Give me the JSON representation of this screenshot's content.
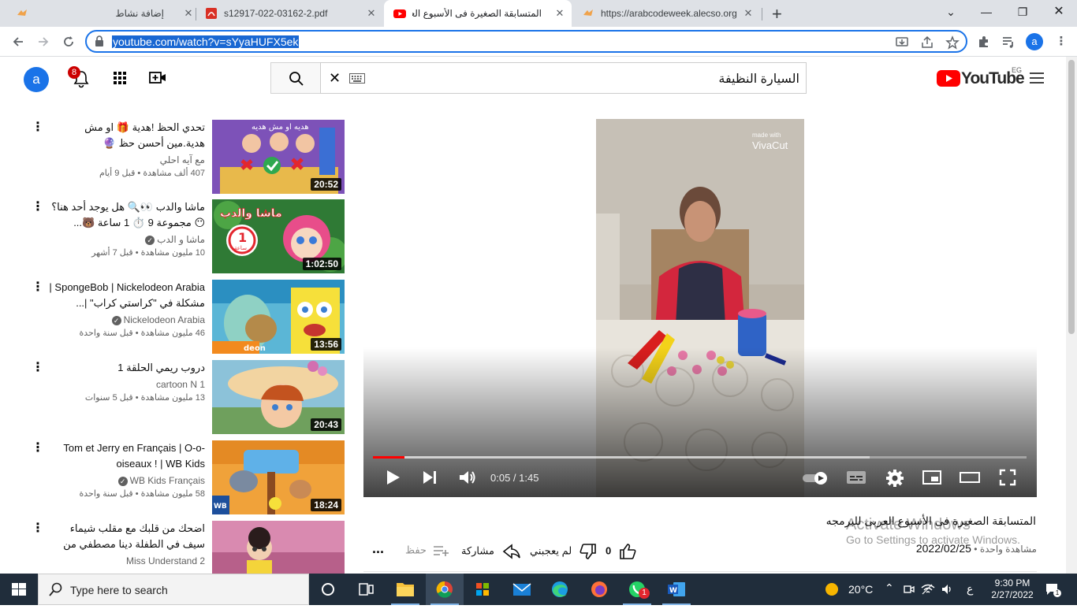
{
  "browser": {
    "tabs": [
      {
        "title": "إضافة نشاط",
        "icon": "arabcode-icon"
      },
      {
        "title": "s12917-022-03162-2.pdf",
        "icon": "pdf-icon"
      },
      {
        "title": "المتسابقة الصغيرة فى الأسبوع العر",
        "icon": "youtube-icon",
        "active": true
      },
      {
        "title": "https://arabcodeweek.alecso.org",
        "icon": "arabcode-icon"
      }
    ],
    "new_tab": "+",
    "url": "youtube.com/watch?v=sYyaHUFX5ek",
    "profile_initial": "a"
  },
  "youtube": {
    "avatar_initial": "a",
    "notification_count": "8",
    "search_query": "السيارة النظيفة",
    "logo_text": "YouTube",
    "country_code": "EG"
  },
  "related": [
    {
      "title": "تحدي الحظ !هدية 🎁 او مش هدية.مين أحسن حظ 🔮",
      "channel": "مع آيه احلي",
      "verified": false,
      "stats": "407 ألف مشاهدة • قبل 9 أيام",
      "duration": "20:52",
      "thumb_color": "#8e5fa8"
    },
    {
      "title": "ماشا والدب 👀🔍 هل يوجد أحد هنا؟ 😶 مجموعة 9 ⏱️ 1 ساعة 🐻...",
      "channel": "ماشا و الدب",
      "verified": true,
      "stats": "10 مليون مشاهدة • قبل 7 أشهر",
      "duration": "1:02:50",
      "thumb_color": "#3f8f3a"
    },
    {
      "title": "SpongeBob | Nickelodeon Arabia | مشكلة في \"كراستي كراب\" |...",
      "channel": "Nickelodeon Arabia",
      "verified": true,
      "stats": "46 مليون مشاهدة • قبل سنة واحدة",
      "duration": "13:56",
      "thumb_color": "#e9c430"
    },
    {
      "title": "دروب ريمي الحلقة 1",
      "channel": "cartoon N 1",
      "verified": false,
      "stats": "13 مليون مشاهدة • قبل 5 سنوات",
      "duration": "20:43",
      "thumb_color": "#c98a55"
    },
    {
      "title": "Tom et Jerry en Français | O-o-oiseaux ! | WB Kids",
      "channel": "WB Kids Français",
      "verified": true,
      "stats": "58 مليون مشاهدة • قبل سنة واحدة",
      "duration": "18:24",
      "thumb_color": "#3d6fa8"
    },
    {
      "title": "اضحك من قلبك مع مقلب شيماء سيف في الطفلة دينا مصطفي من برنامج ميس...",
      "channel": "Miss Understand 2",
      "verified": false,
      "stats": "",
      "duration": "",
      "thumb_color": "#c27a9a"
    }
  ],
  "player": {
    "time_current": "0:05",
    "time_total": "1:45",
    "time_text": "0:05 / 1:45",
    "progress": 0.048,
    "watermark_small": "made with",
    "watermark": "VivaCut"
  },
  "video": {
    "title": "المتسابقة الصغيرة فى الأسبوع العربى للبرمجه",
    "views": "مشاهدة واحدة •",
    "date": "2022/02/25",
    "likes": "0",
    "dislike_label": "لم يعجبني",
    "share_label": "مشاركة",
    "save_label": "حفظ",
    "more": "..."
  },
  "watermark": {
    "line1": "Activate Windows",
    "line2": "Go to Settings to activate Windows."
  },
  "taskbar": {
    "search_placeholder": "Type here to search",
    "weather": "20°C",
    "lang": "ع",
    "time": "9:30 PM",
    "date": "2/27/2022",
    "whatsapp_badge": "1",
    "notif_count": "1"
  }
}
